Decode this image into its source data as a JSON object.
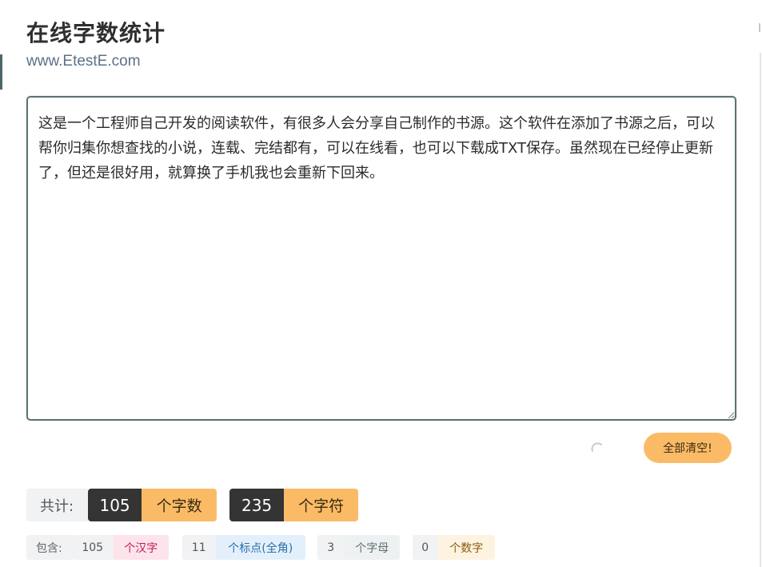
{
  "header": {
    "title": "在线字数统计",
    "subtitle": "www.EtestE.com"
  },
  "editor": {
    "content": "这是一个工程师自己开发的阅读软件，有很多人会分享自己制作的书源。这个软件在添加了书源之后，可以帮你归集你想查找的小说，连载、完结都有，可以在线看，也可以下载成TXT保存。虽然现在已经停止更新了，但还是很好用，就算换了手机我也会重新下回来。"
  },
  "actions": {
    "clear_label": "全部清空!"
  },
  "totals": {
    "label": "共计:",
    "words": {
      "value": "105",
      "unit": "个字数"
    },
    "chars": {
      "value": "235",
      "unit": "个字符"
    }
  },
  "details": {
    "label": "包含:",
    "items": [
      {
        "value": "105",
        "unit": "个汉字",
        "color": "#c2185b",
        "bg": "#fde4ea"
      },
      {
        "value": "11",
        "unit": "个标点(全角)",
        "color": "#2a6fa8",
        "bg": "#e3f0fb"
      },
      {
        "value": "3",
        "unit": "个字母",
        "color": "#5c6f73",
        "bg": "#eef1f2"
      },
      {
        "value": "0",
        "unit": "个数字",
        "color": "#8a5a10",
        "bg": "#fdf3e0"
      }
    ]
  },
  "colors": {
    "accent": "#fbbb66",
    "dark_badge": "#343434",
    "border": "#5c7375"
  }
}
